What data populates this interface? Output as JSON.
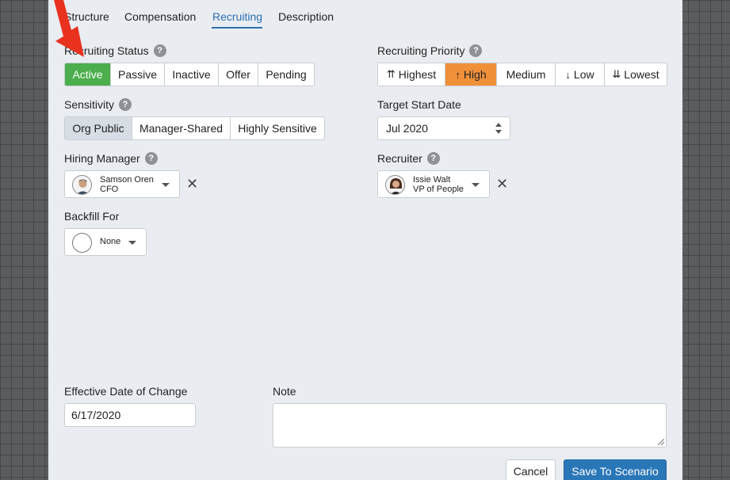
{
  "tabs": [
    {
      "label": "Structure"
    },
    {
      "label": "Compensation"
    },
    {
      "label": "Recruiting"
    },
    {
      "label": "Description"
    }
  ],
  "active_tab": "Recruiting",
  "recruiting_status": {
    "label": "Recruiting Status",
    "options": [
      "Active",
      "Passive",
      "Inactive",
      "Offer",
      "Pending"
    ],
    "selected": "Active"
  },
  "recruiting_priority": {
    "label": "Recruiting Priority",
    "options": [
      {
        "icon": "⇈",
        "label": "Highest"
      },
      {
        "icon": "↑",
        "label": "High"
      },
      {
        "icon": "",
        "label": "Medium"
      },
      {
        "icon": "↓",
        "label": "Low"
      },
      {
        "icon": "⇊",
        "label": "Lowest"
      }
    ],
    "selected": "High"
  },
  "sensitivity": {
    "label": "Sensitivity",
    "options": [
      "Org Public",
      "Manager-Shared",
      "Highly Sensitive"
    ],
    "selected": "Org Public"
  },
  "target_start_date": {
    "label": "Target Start Date",
    "value": "Jul 2020"
  },
  "hiring_manager": {
    "label": "Hiring Manager",
    "name": "Samson Oren",
    "title": "CFO"
  },
  "recruiter": {
    "label": "Recruiter",
    "name": "Issie Walt",
    "title": "VP of People"
  },
  "backfill_for": {
    "label": "Backfill For",
    "value": "None"
  },
  "effective_date": {
    "label": "Effective Date of Change",
    "value": "6/17/2020"
  },
  "note": {
    "label": "Note",
    "value": ""
  },
  "buttons": {
    "cancel": "Cancel",
    "save": "Save To Scenario"
  },
  "help_glyph": "?",
  "clear_glyph": "✕",
  "colors": {
    "accent": "#2a6fb0",
    "active_green": "#4cae4c",
    "priority_orange": "#f0913a",
    "save_blue": "#2a77b8",
    "annotation_arrow": "#e8321e"
  }
}
